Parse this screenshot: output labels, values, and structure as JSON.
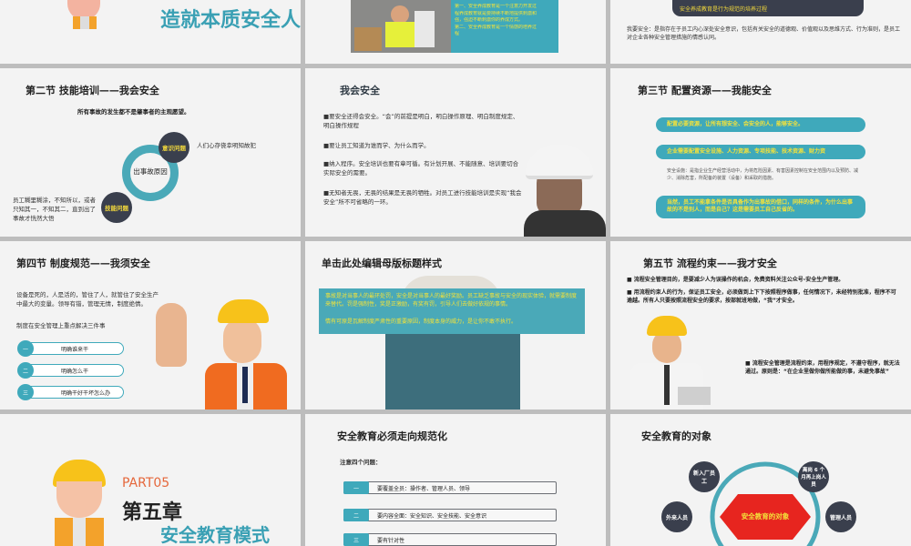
{
  "slide1": {
    "heading": "造就本质安全人"
  },
  "slide2": {
    "lines": [
      "第一、安全养成教育是一个注意力开发过",
      "程养成教育就是要持续不断地提供刺激和",
      "强，强迫不断刺激你的养成方式。",
      "第二、安全养成教育是一个情感的培养过",
      "程"
    ]
  },
  "slide3": {
    "banner": "安全养成教育是行为规范的培养过程",
    "text": "我要安全：是指存在于员工内心深处安全意识，包括有关安全的道德观、价值观以及思维方式、行为准则，是员工对企业各种安全管理措施的情感认同。"
  },
  "slide4": {
    "title": "第二节  技能培训——我会安全",
    "subtitle": "所有事故的发生都不是肇事者的主观愿望。",
    "center": "出事故原因",
    "c1": "意识问题",
    "c1_text": "人们心存侥幸明知故犯",
    "c2": "技能问题",
    "c2_text": "员工糊里糊涂，不知所以，或者只知其一，不知其二，直到出了事故才恍然大悟"
  },
  "slide5": {
    "title": "我会安全",
    "paras": [
      "■要安全还得会安全。“会”的前提是明白，明白操作原理、明白制度规定、明白操作规程",
      "■要让员工知道为谁而学、为什么而学。",
      "■纳入程序。安全培训也要有章可循。有计划开展、不能随意、培训要切合实际安全的需要。",
      "■无知者无畏，无畏的结果是无畏的牺牲。对员工进行技能培训是实现“我会安全”所不可省略的一环。"
    ]
  },
  "slide6": {
    "title": "第三节    配置资源——我能安全",
    "pill1": "配置必要资源，让所有想安全、会安全的人，能够安全。",
    "pill2": "企业需要配置安全设施、人力资源、专项技能、技术资源、财力资",
    "note": "安全设施：是指企业生产经营活动中，为将危险因素、有害因素控制在安全范围内以及预防、减少、消除危害，所配备的装置（设备）和采取的措施。",
    "pill3": "当然，员工不能拿条件是否具备作为出事故的借口，同样的条件，为什么出事故的不是别人，而是自己？这是需要员工自己反省的。"
  },
  "slide7": {
    "title": "第四节  制度规范——我须安全",
    "text": "设备是死的，人是活的，管住了人，就管住了安全生产中最大的变量。领导有错，管理无情，制度绝情。",
    "sub": "制度在安全管理上重点解决三件事",
    "items": [
      {
        "num": "一",
        "label": "明确谁来干"
      },
      {
        "num": "二",
        "label": "明确怎么干"
      },
      {
        "num": "三",
        "label": "明确干好干坏怎么办"
      }
    ]
  },
  "slide8": {
    "title": "单击此处编辑母版标题样式",
    "items": [
      "事故是对当事人的最环处罚，安全是对当事人的最好奖励。员工缺乏事故与安全的现实体验，就需要制度来替代。罚是强制性，奖是正激励，有奖有罚，引导人们去做好依规的事情。",
      "情有可原是瓦解制度严肃性的重要原因，制度本身的威力，是让你不敢不执行。"
    ]
  },
  "slide9": {
    "title": "第五节     流程约束——我才安全",
    "paras": [
      "■ 流程安全管理目的，是要减少人为误操作的机会，免费资料关注公众号-安全生产管理。",
      "■ 用流程约束人的行为，保证员工安全，必须做到上下下按照程序做事，任何情况下，未经特别批准，程序不可逾越。所有人只要按照流程安全的要求，按部就班地做，“我”才安全。"
    ],
    "note": "■ 流程安全管理是流程约束，用程序规定，不遵守程序，就无法通过。原则是：“在企业里做你做所能做的事，未避免事故”"
  },
  "slide10": {
    "part": "PART05",
    "chapter": "第五章",
    "name": "安全教育模式"
  },
  "slide11": {
    "title": "安全教育必须走向规范化",
    "sub": "注意四个问题：",
    "items": [
      {
        "num": "一",
        "label": "要覆盖全员：操作者、管理人员、领导"
      },
      {
        "num": "二",
        "label": "要内容全面：安全知识、安全技能、安全意识"
      },
      {
        "num": "三",
        "label": "要有针对性"
      }
    ]
  },
  "slide12": {
    "title": "安全教育的对象",
    "center": "安全教育的对象",
    "nodes": [
      "新入厂员工",
      "离岗 6 个月再上岗人员",
      "外来人员",
      "管理人员"
    ]
  }
}
